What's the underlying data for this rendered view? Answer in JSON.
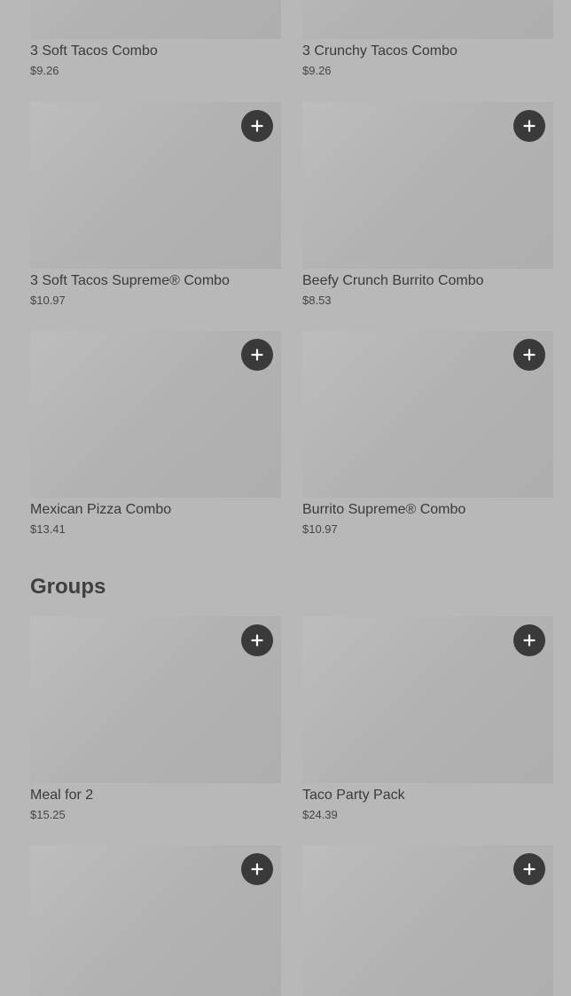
{
  "combos": {
    "items": [
      {
        "name": "3 Soft Tacos Combo",
        "price": "$9.26"
      },
      {
        "name": "3 Crunchy Tacos Combo",
        "price": "$9.26"
      },
      {
        "name": "3 Soft Tacos Supreme® Combo",
        "price": "$10.97"
      },
      {
        "name": "Beefy Crunch Burrito Combo",
        "price": "$8.53"
      },
      {
        "name": "Mexican Pizza Combo",
        "price": "$13.41"
      },
      {
        "name": "Burrito Supreme® Combo",
        "price": "$10.97"
      }
    ]
  },
  "groups": {
    "title": "Groups",
    "items": [
      {
        "name": "Meal for 2",
        "price": "$15.25"
      },
      {
        "name": "Taco Party Pack",
        "price": "$24.39"
      },
      {
        "name": "",
        "price": ""
      },
      {
        "name": "",
        "price": ""
      }
    ]
  },
  "icons": {
    "add": "plus-icon"
  },
  "colors": {
    "background": "#b8b8b8",
    "image_placeholder": "#b2b2b2",
    "add_button": "#3a3a3a",
    "text": "#3a3a3a"
  }
}
